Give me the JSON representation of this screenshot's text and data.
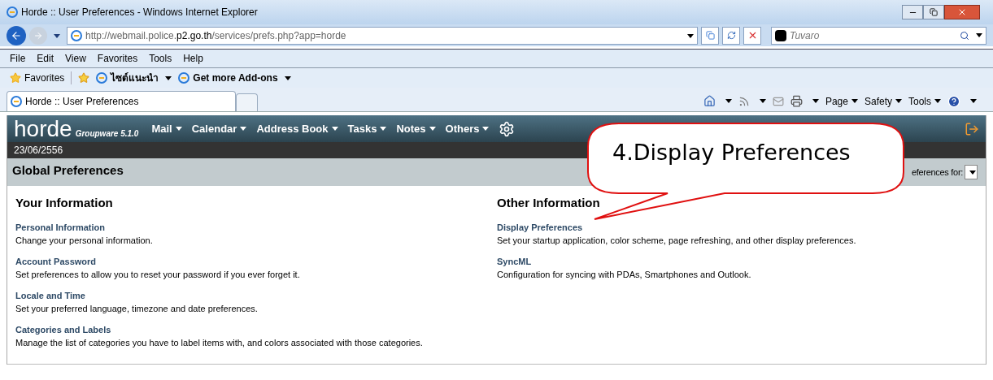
{
  "window": {
    "title": "Horde :: User Preferences - Windows Internet Explorer"
  },
  "address_bar": {
    "url_start": "http://webmail.police.",
    "url_domain": "p2.go.th",
    "url_end": "/services/prefs.php?app=horde"
  },
  "search": {
    "placeholder": "Tuvaro"
  },
  "menu_bar": [
    "File",
    "Edit",
    "View",
    "Favorites",
    "Tools",
    "Help"
  ],
  "favorites_bar": {
    "favorites": "Favorites",
    "links": [
      "ไซต์แนะนำ",
      "Get more Add-ons"
    ]
  },
  "tabs": [
    {
      "label": "Horde :: User Preferences",
      "selected": true
    }
  ],
  "command_bar": [
    "Page",
    "Safety",
    "Tools"
  ],
  "horde": {
    "logo": "horde",
    "product": "Groupware 5.1.0",
    "menu": [
      "Mail",
      "Calendar",
      "Address Book",
      "Tasks",
      "Notes",
      "Others"
    ],
    "date": "23/06/2556"
  },
  "page": {
    "title": "Global Preferences",
    "select_label": "eferences for:",
    "columns": [
      {
        "heading": "Your Information",
        "items": [
          {
            "link": "Personal Information",
            "description": "Change your personal information."
          },
          {
            "link": "Account Password",
            "description": "Set preferences to allow you to reset your password if you ever forget it."
          },
          {
            "link": "Locale and Time",
            "description": "Set your preferred language, timezone and date preferences."
          },
          {
            "link": "Categories and Labels",
            "description": "Manage the list of categories you have to label items with, and colors associated with those categories."
          }
        ]
      },
      {
        "heading": "Other Information",
        "items": [
          {
            "link": "Display Preferences",
            "description": "Set your startup application, color scheme, page refreshing, and other display preferences."
          },
          {
            "link": "SyncML",
            "description": "Configuration for syncing with PDAs, Smartphones and Outlook."
          }
        ]
      }
    ]
  },
  "callout": {
    "text": "4.Display Preferences"
  }
}
